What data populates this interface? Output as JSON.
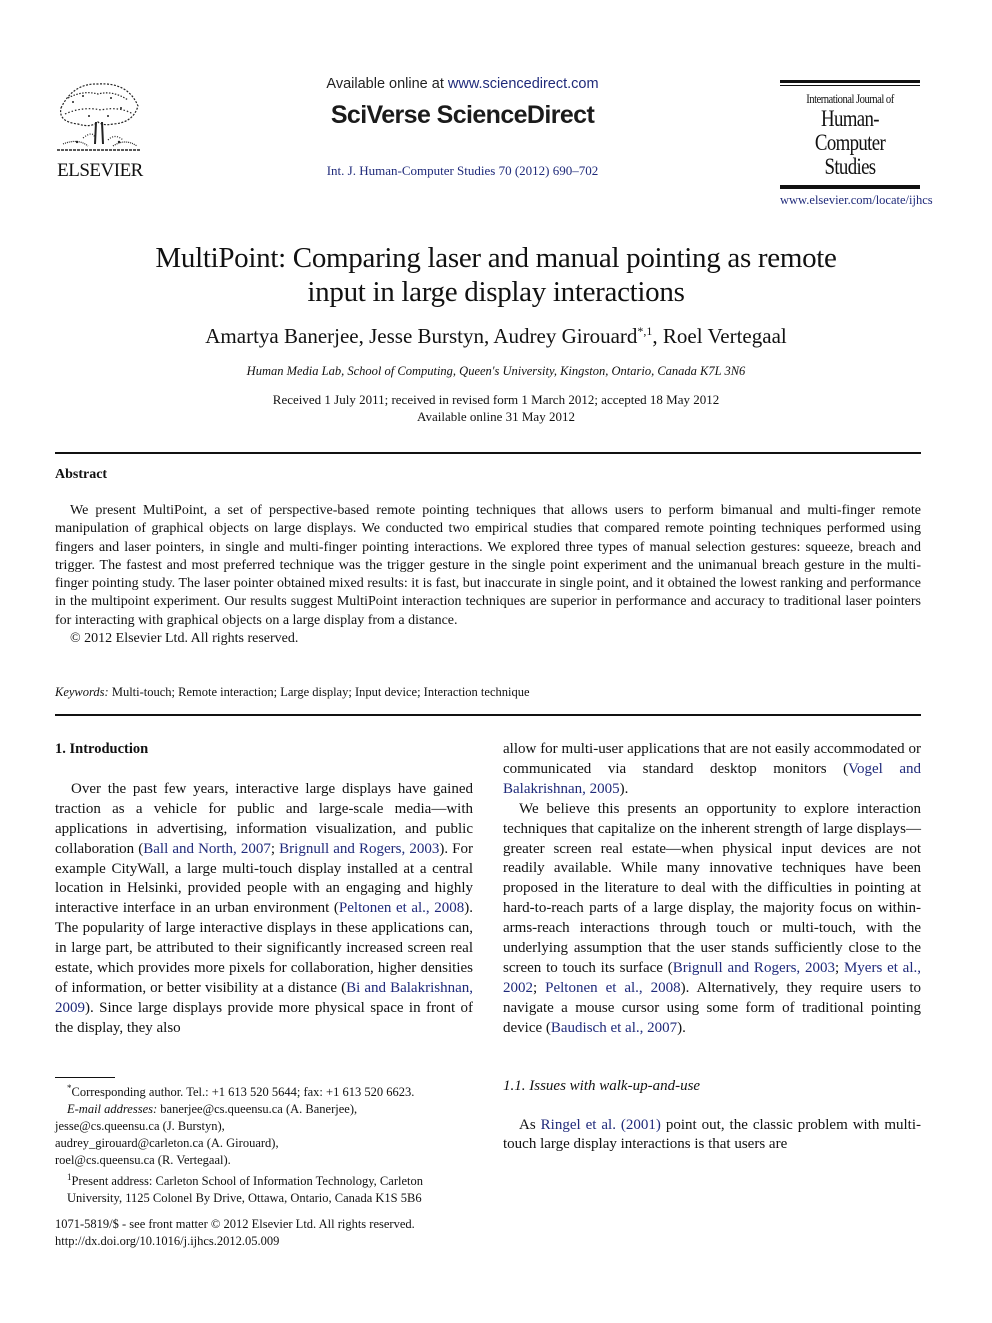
{
  "header": {
    "publisher_name": "ELSEVIER",
    "available_prefix": "Available online at ",
    "available_url": "www.sciencedirect.com",
    "platform_name": "SciVerse ScienceDirect",
    "journal_citation": "Int. J. Human-Computer Studies 70 (2012) 690–702",
    "journal_box": {
      "line1": "International Journal of",
      "line2": "Human-Computer",
      "line3": "Studies",
      "url": "www.elsevier.com/locate/ijhcs"
    }
  },
  "article": {
    "title_line1": "MultiPoint: Comparing laser and manual pointing as remote",
    "title_line2": "input in large display interactions",
    "authors_part1": "Amartya Banerjee, Jesse Burstyn, Audrey Girouard",
    "authors_sup": "*,1",
    "authors_part2": ", Roel Vertegaal",
    "affiliation": "Human Media Lab, School of Computing, Queen's University, Kingston, Ontario, Canada K7L 3N6",
    "dates_line1": "Received 1 July 2011; received in revised form 1 March 2012; accepted 18 May 2012",
    "dates_line2": "Available online 31 May 2012"
  },
  "abstract": {
    "heading": "Abstract",
    "body": "We present MultiPoint, a set of perspective-based remote pointing techniques that allows users to perform bimanual and multi-finger remote manipulation of graphical objects on large displays. We conducted two empirical studies that compared remote pointing techniques performed using fingers and laser pointers, in single and multi-finger pointing interactions. We explored three types of manual selection gestures: squeeze, breach and trigger. The fastest and most preferred technique was the trigger gesture in the single point experiment and the unimanual breach gesture in the multi-finger pointing study. The laser pointer obtained mixed results: it is fast, but inaccurate in single point, and it obtained the lowest ranking and performance in the multipoint experiment. Our results suggest MultiPoint interaction techniques are superior in performance and accuracy to traditional laser pointers for interacting with graphical objects on a large display from a distance.",
    "copyright": "© 2012 Elsevier Ltd. All rights reserved.",
    "keywords_label": "Keywords:",
    "keywords": "Multi-touch; Remote interaction; Large display; Input device; Interaction technique"
  },
  "intro": {
    "heading": "1.  Introduction",
    "p1_a": "Over the past few years, interactive large displays have gained traction as a vehicle for public and large-scale media—with applications in advertising, information visualization, and public collaboration (",
    "p1_link1": "Ball and North, 2007",
    "p1_b": "; ",
    "p1_link2": "Brignull and Rogers, 2003",
    "p1_c": "). For example CityWall, a large multi-touch display installed at a central location in Helsinki, provided people with an engaging and highly interactive interface in an urban environment (",
    "p1_link3": "Peltonen et al., 2008",
    "p1_d": "). The popularity of large interactive displays in these applications can, in large part, be attributed to their significantly increased screen real estate, which provides more pixels for collaboration, higher densities of information, or better visibility at a distance (",
    "p1_link4": "Bi and Balakrishnan, 2009",
    "p1_e": "). Since large displays provide more physical space in front of the display, they also allow for multi-user applications that are not easily accommodated or communicated via standard desktop monitors (",
    "p1_link5": "Vogel and Balakrishnan, 2005",
    "p1_f": ").",
    "p2_a": "We believe this presents an opportunity to explore interaction techniques that capitalize on the inherent strength of large displays—greater screen real estate—when physical input devices are not readily available. While many innovative techniques have been proposed in the literature to deal with the difficulties in pointing at hard-to-reach parts of a large display, the majority focus on within-arms-reach interactions through touch or multi-touch, with the underlying assumption that the user stands sufficiently close to the screen to touch its surface (",
    "p2_link1": "Brignull and Rogers, 2003",
    "p2_b": "; ",
    "p2_link2": "Myers et al., 2002",
    "p2_c": "; ",
    "p2_link3": "Peltonen et al., 2008",
    "p2_d": "). Alternatively, they require users to navigate a mouse cursor using some form of traditional pointing device (",
    "p2_link4": "Baudisch et al., 2007",
    "p2_e": ").",
    "subsection_heading": "1.1.  Issues with walk-up-and-use",
    "p3_link1": "Ringel et al. (2001)",
    "p3_a": " point out, the classic problem with multi-touch large display interactions is that users are",
    "p3_prefix": "As "
  },
  "footnotes": {
    "corresponding": "Corresponding author. Tel.: +1 613 520 5644; fax: +1 613 520 6623.",
    "corresponding_mark": "*",
    "email_label": "E-mail addresses:",
    "email1": " banerjee@cs.queensu.ca (A. Banerjee),",
    "email2": "jesse@cs.queensu.ca (J. Burstyn),",
    "email3": "audrey_girouard@carleton.ca (A. Girouard),",
    "email4": "roel@cs.queensu.ca (R. Vertegaal).",
    "present_mark": "1",
    "present_address": "Present address: Carleton School of Information Technology, Carleton University, 1125 Colonel By Drive, Ottawa, Ontario, Canada K1S 5B6"
  },
  "bottom": {
    "issn_line": "1071-5819/$ - see front matter © 2012 Elsevier Ltd. All rights reserved.",
    "doi": "http://dx.doi.org/10.1016/j.ijhcs.2012.05.009"
  }
}
